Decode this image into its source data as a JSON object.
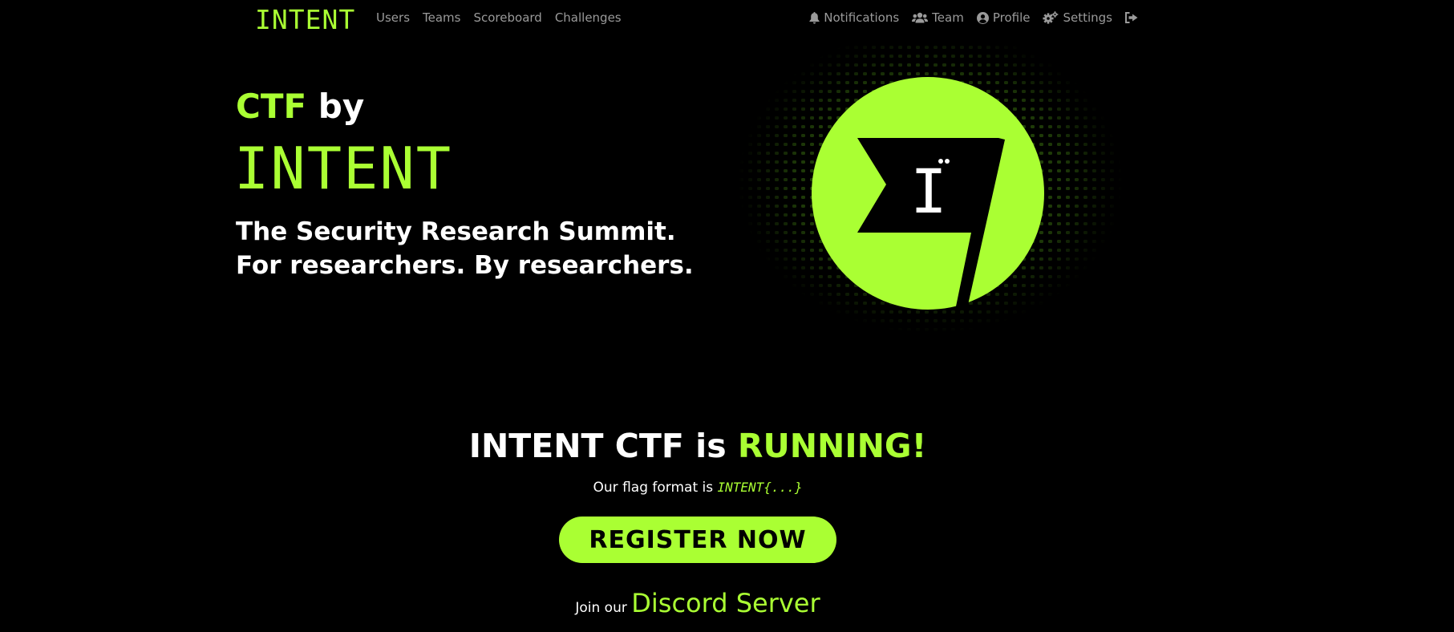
{
  "navbar": {
    "brand": "INTENT",
    "left_links": [
      {
        "label": "Users"
      },
      {
        "label": "Teams"
      },
      {
        "label": "Scoreboard"
      },
      {
        "label": "Challenges"
      }
    ],
    "right_links": [
      {
        "label": "Notifications",
        "icon": "bell-icon"
      },
      {
        "label": "Team",
        "icon": "users-icon"
      },
      {
        "label": "Profile",
        "icon": "user-circle-icon"
      },
      {
        "label": "Settings",
        "icon": "gears-icon"
      }
    ],
    "logout_icon": "sign-out-icon"
  },
  "hero": {
    "title_accent": "CTF",
    "title_rest": " by",
    "wordmark": "INTENT",
    "tagline_line1": "The Security Research Summit.",
    "tagline_line2": "For researchers. By researchers.",
    "logo_letter": "I"
  },
  "status": {
    "headline_prefix": "INTENT CTF is ",
    "headline_accent": "RUNNING!",
    "flag_text": "Our flag format is ",
    "flag_format": "INTENT{...}",
    "register_label": "REGISTER NOW",
    "discord_prefix": "Join our ",
    "discord_link": "Discord Server"
  },
  "colors": {
    "accent": "#aaff33",
    "background": "#000000",
    "nav_text": "#9a9a9a"
  }
}
